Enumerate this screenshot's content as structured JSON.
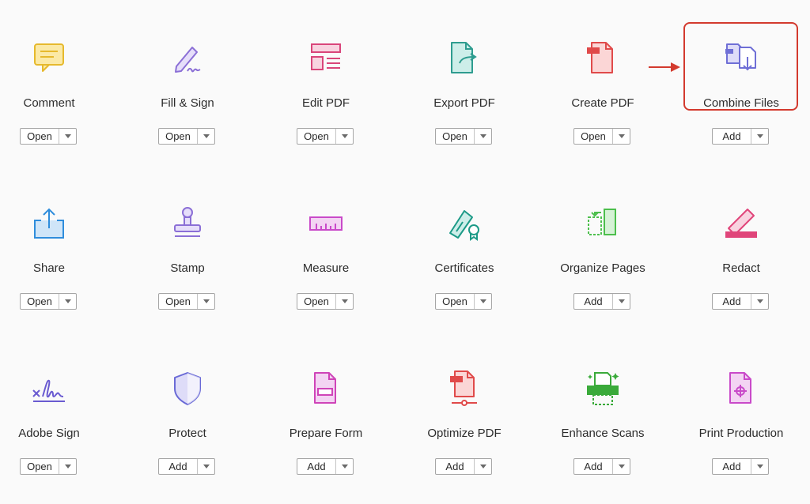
{
  "tools": [
    {
      "id": "comment",
      "name": "Comment",
      "action": "Open",
      "icon": "comment-icon",
      "color": "#e6b92d"
    },
    {
      "id": "fill-sign",
      "name": "Fill & Sign",
      "action": "Open",
      "icon": "fill-sign-icon",
      "color": "#8b6fd6"
    },
    {
      "id": "edit-pdf",
      "name": "Edit PDF",
      "action": "Open",
      "icon": "edit-pdf-icon",
      "color": "#d9457a"
    },
    {
      "id": "export-pdf",
      "name": "Export PDF",
      "action": "Open",
      "icon": "export-pdf-icon",
      "color": "#2e9c8f"
    },
    {
      "id": "create-pdf",
      "name": "Create PDF",
      "action": "Open",
      "icon": "create-pdf-icon",
      "color": "#e04a4a"
    },
    {
      "id": "combine-files",
      "name": "Combine Files",
      "action": "Add",
      "icon": "combine-files-icon",
      "color": "#6f6fd6"
    },
    {
      "id": "share",
      "name": "Share",
      "action": "Open",
      "icon": "share-icon",
      "color": "#2f8ddc"
    },
    {
      "id": "stamp",
      "name": "Stamp",
      "action": "Open",
      "icon": "stamp-icon",
      "color": "#8b6fd6"
    },
    {
      "id": "measure",
      "name": "Measure",
      "action": "Open",
      "icon": "measure-icon",
      "color": "#c94ac9"
    },
    {
      "id": "certificates",
      "name": "Certificates",
      "action": "Open",
      "icon": "certificates-icon",
      "color": "#1c9a87"
    },
    {
      "id": "organize-pages",
      "name": "Organize Pages",
      "action": "Add",
      "icon": "organize-pages-icon",
      "color": "#4cbf4c"
    },
    {
      "id": "redact",
      "name": "Redact",
      "action": "Add",
      "icon": "redact-icon",
      "color": "#e0457a"
    },
    {
      "id": "adobe-sign",
      "name": "Adobe Sign",
      "action": "Open",
      "icon": "adobe-sign-icon",
      "color": "#6a5bd1"
    },
    {
      "id": "protect",
      "name": "Protect",
      "action": "Add",
      "icon": "protect-icon",
      "color": "#6a6ad6"
    },
    {
      "id": "prepare-form",
      "name": "Prepare Form",
      "action": "Add",
      "icon": "prepare-form-icon",
      "color": "#cf44b8"
    },
    {
      "id": "optimize-pdf",
      "name": "Optimize PDF",
      "action": "Add",
      "icon": "optimize-pdf-icon",
      "color": "#e04a4a"
    },
    {
      "id": "enhance-scans",
      "name": "Enhance Scans",
      "action": "Add",
      "icon": "enhance-scans-icon",
      "color": "#3aaa3a"
    },
    {
      "id": "print-production",
      "name": "Print Production",
      "action": "Add",
      "icon": "print-production-icon",
      "color": "#c94ac9"
    }
  ],
  "highlight_color": "#d33a2e"
}
